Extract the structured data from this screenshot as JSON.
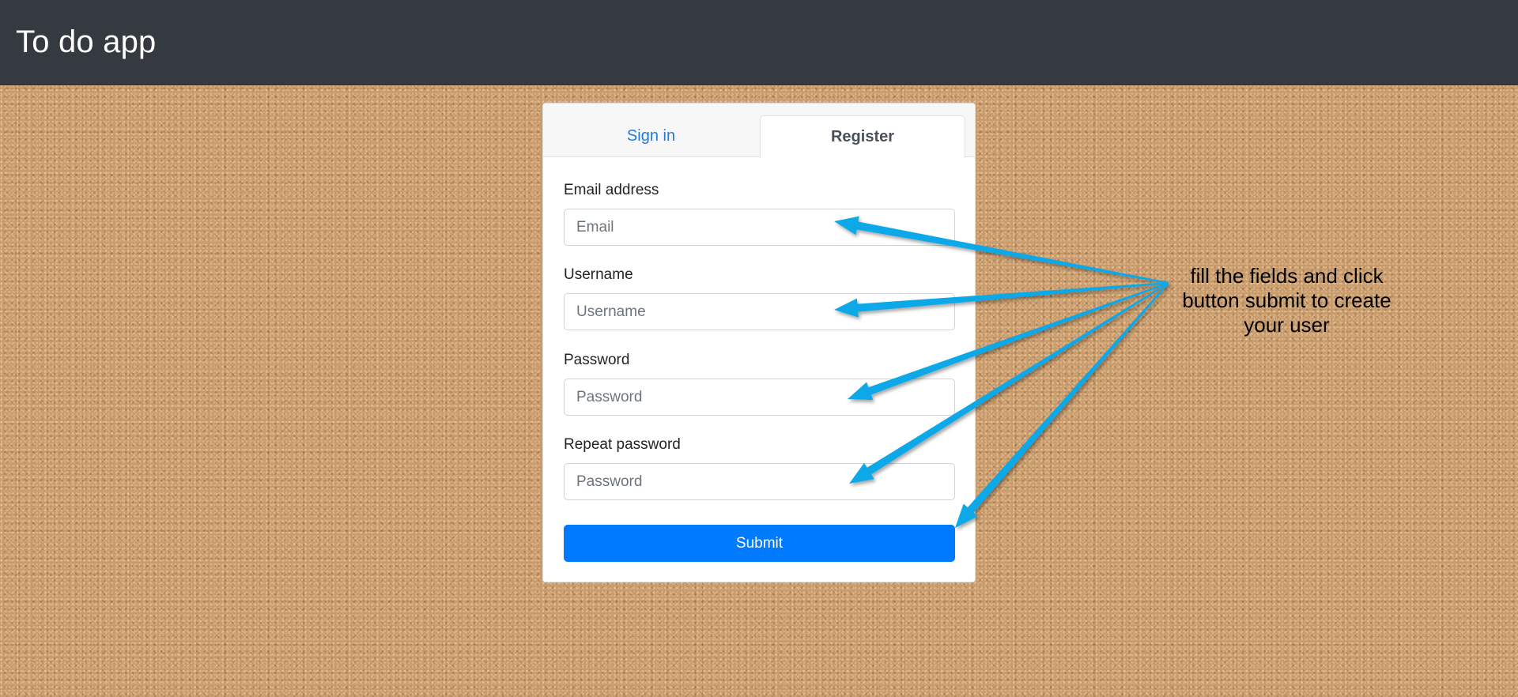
{
  "app": {
    "title": "To do app"
  },
  "tabs": [
    {
      "label": "Sign in",
      "active": false
    },
    {
      "label": "Register",
      "active": true
    }
  ],
  "form": {
    "email": {
      "label": "Email address",
      "placeholder": "Email",
      "value": ""
    },
    "username": {
      "label": "Username",
      "placeholder": "Username",
      "value": ""
    },
    "password": {
      "label": "Password",
      "placeholder": "Password",
      "value": ""
    },
    "repeat_password": {
      "label": "Repeat password",
      "placeholder": "Password",
      "value": ""
    },
    "submit_label": "Submit"
  },
  "annotation": {
    "text": "fill the fields and click button submit to create your user",
    "arrow_color": "#0aa8e8"
  },
  "colors": {
    "navbar": "#343a40",
    "primary": "#007bff",
    "tab_link": "#1e7ce0",
    "background": "#c79a6c"
  }
}
